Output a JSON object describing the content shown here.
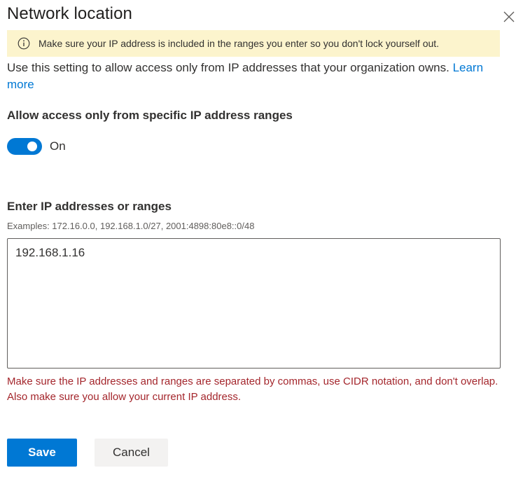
{
  "panel": {
    "title": "Network location",
    "close_icon": "close-icon"
  },
  "warning": {
    "icon": "info-icon",
    "text": "Make sure your IP address is included in the ranges you enter so you don't lock yourself out.",
    "background": "#fcf4cd"
  },
  "description": {
    "text": "Use this setting to allow access only from IP addresses that your organization owns. ",
    "link": "Learn more"
  },
  "toggle": {
    "label": "Allow access only from specific IP address ranges",
    "state_text": "On",
    "checked": true,
    "color": "#0078d4"
  },
  "ip_input": {
    "label": "Enter IP addresses or ranges",
    "examples": "Examples: 172.16.0.0, 192.168.1.0/27, 2001:4898:80e8::0/48",
    "value": "192.168.1.16"
  },
  "error": {
    "text": "Make sure the IP addresses and ranges are separated by commas, use CIDR notation, and don't overlap. Also make sure you allow your current IP address.",
    "color": "#a4262c"
  },
  "actions": {
    "save_label": "Save",
    "cancel_label": "Cancel"
  }
}
